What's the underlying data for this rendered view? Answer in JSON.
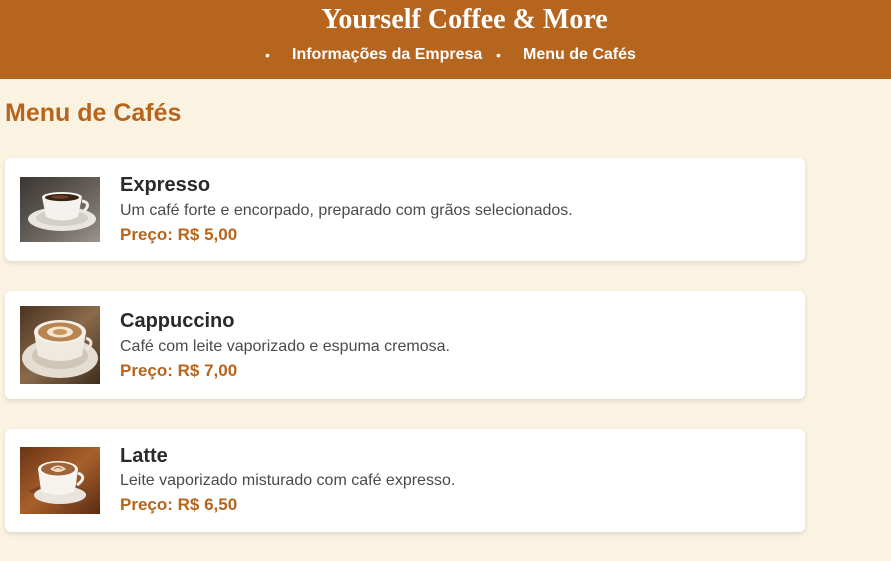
{
  "header": {
    "title": "Yourself Coffee & More",
    "nav": [
      {
        "label": "Informações da Empresa"
      },
      {
        "label": "Menu de Cafés"
      }
    ]
  },
  "main": {
    "heading": "Menu de Cafés",
    "items": [
      {
        "name": "Expresso",
        "description": "Um café forte e encorpado, preparado com grãos selecionados.",
        "price": "Preço: R$ 5,00",
        "image_icon": "espresso-cup-photo"
      },
      {
        "name": "Cappuccino",
        "description": "Café com leite vaporizado e espuma cremosa.",
        "price": "Preço: R$ 7,00",
        "image_icon": "cappuccino-cup-photo"
      },
      {
        "name": "Latte",
        "description": "Leite vaporizado misturado com café expresso.",
        "price": "Preço: R$ 6,50",
        "image_icon": "latte-cup-photo"
      }
    ]
  },
  "colors": {
    "brand": "#b5651d",
    "background": "#fbf3e2",
    "card": "#ffffff",
    "text": "#2a2a2a"
  }
}
